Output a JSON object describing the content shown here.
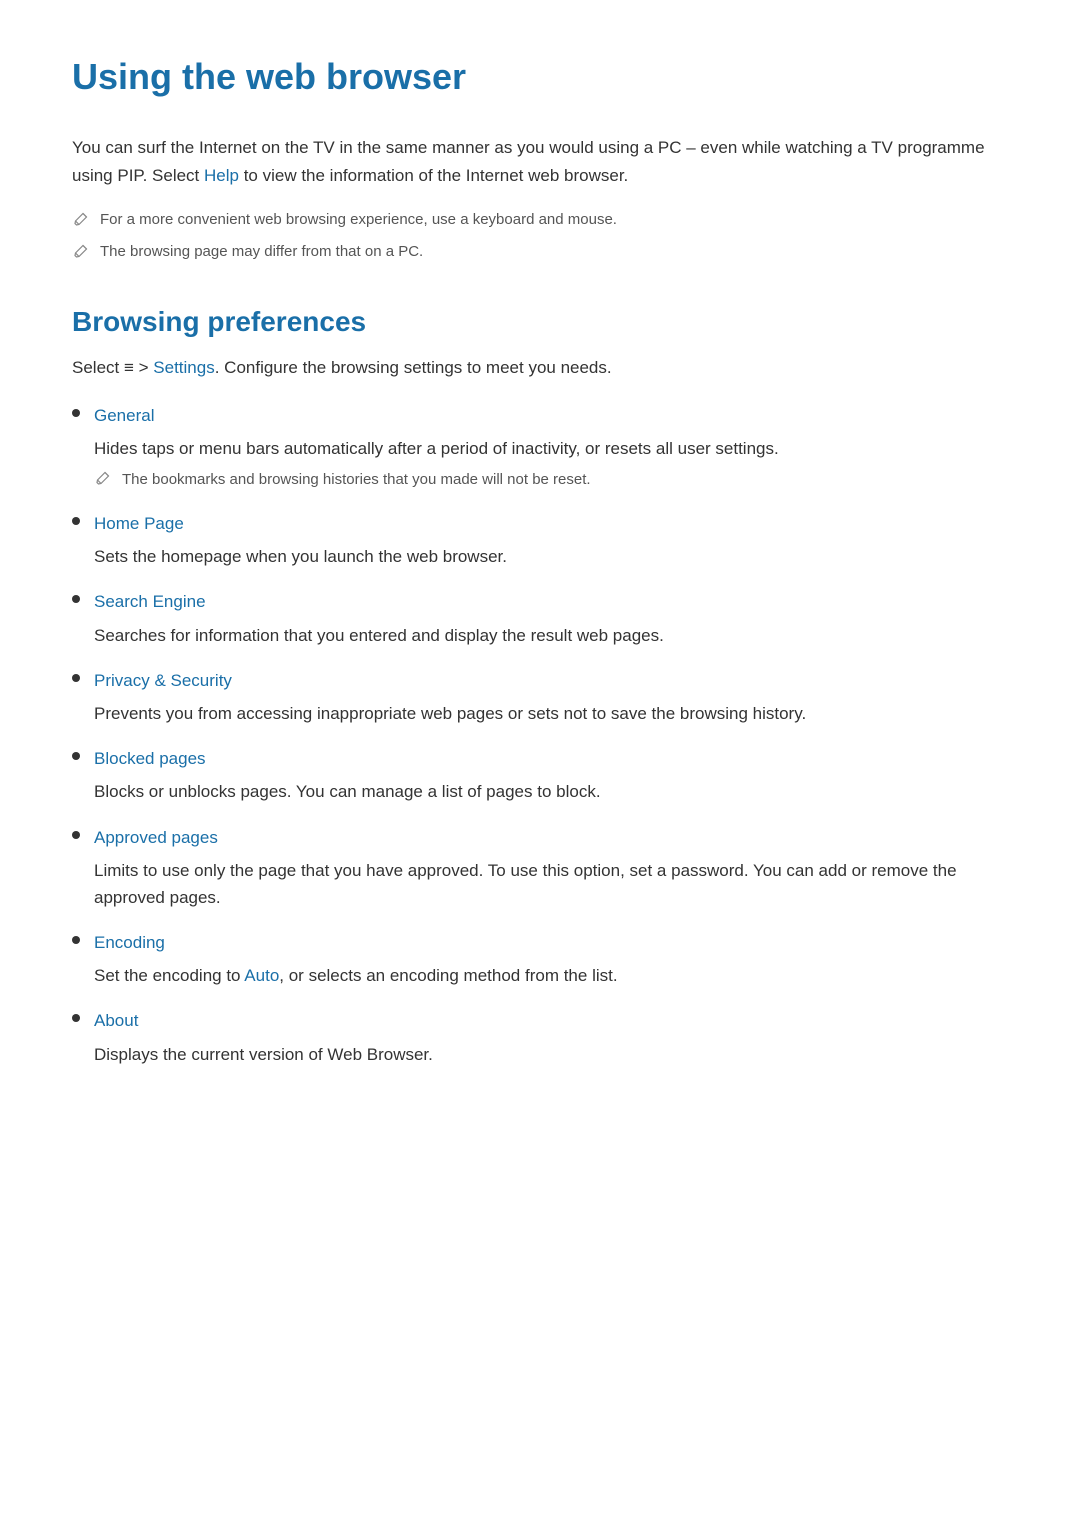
{
  "page": {
    "title": "Using the web browser",
    "intro": {
      "text_before": "You can surf the Internet on the TV in the same manner as you would using a PC – even while watching a TV programme using PIP. Select ",
      "link_text": "Help",
      "text_after": " to view the information of the Internet web browser."
    },
    "notes": [
      "For a more convenient web browsing experience, use a keyboard and mouse.",
      "The browsing page may differ from that on a PC."
    ]
  },
  "browsing_preferences": {
    "section_title": "Browsing preferences",
    "intro_before": "Select ",
    "intro_icon": "≡",
    "intro_middle": " > ",
    "intro_link": "Settings",
    "intro_after": ". Configure the browsing settings to meet you needs.",
    "items": [
      {
        "label": "General",
        "description": "Hides taps or menu bars automatically after a period of inactivity, or resets all user settings.",
        "note": "The bookmarks and browsing histories that you made will not be reset."
      },
      {
        "label": "Home Page",
        "description": "Sets the homepage when you launch the web browser.",
        "note": null
      },
      {
        "label": "Search Engine",
        "description": "Searches for information that you entered and display the result web pages.",
        "note": null
      },
      {
        "label": "Privacy & Security",
        "description": "Prevents you from accessing inappropriate web pages or sets not to save the browsing history.",
        "note": null
      },
      {
        "label": "Blocked pages",
        "description": "Blocks or unblocks pages. You can manage a list of pages to block.",
        "note": null
      },
      {
        "label": "Approved pages",
        "description": "Limits to use only the page that you have approved. To use this option, set a password. You can add or remove the approved pages.",
        "note": null
      },
      {
        "label": "Encoding",
        "description_before": "Set the encoding to ",
        "description_link": "Auto",
        "description_after": ", or selects an encoding method from the list.",
        "note": null,
        "has_link": true
      },
      {
        "label": "About",
        "description": "Displays the current version of Web Browser.",
        "note": null
      }
    ]
  }
}
